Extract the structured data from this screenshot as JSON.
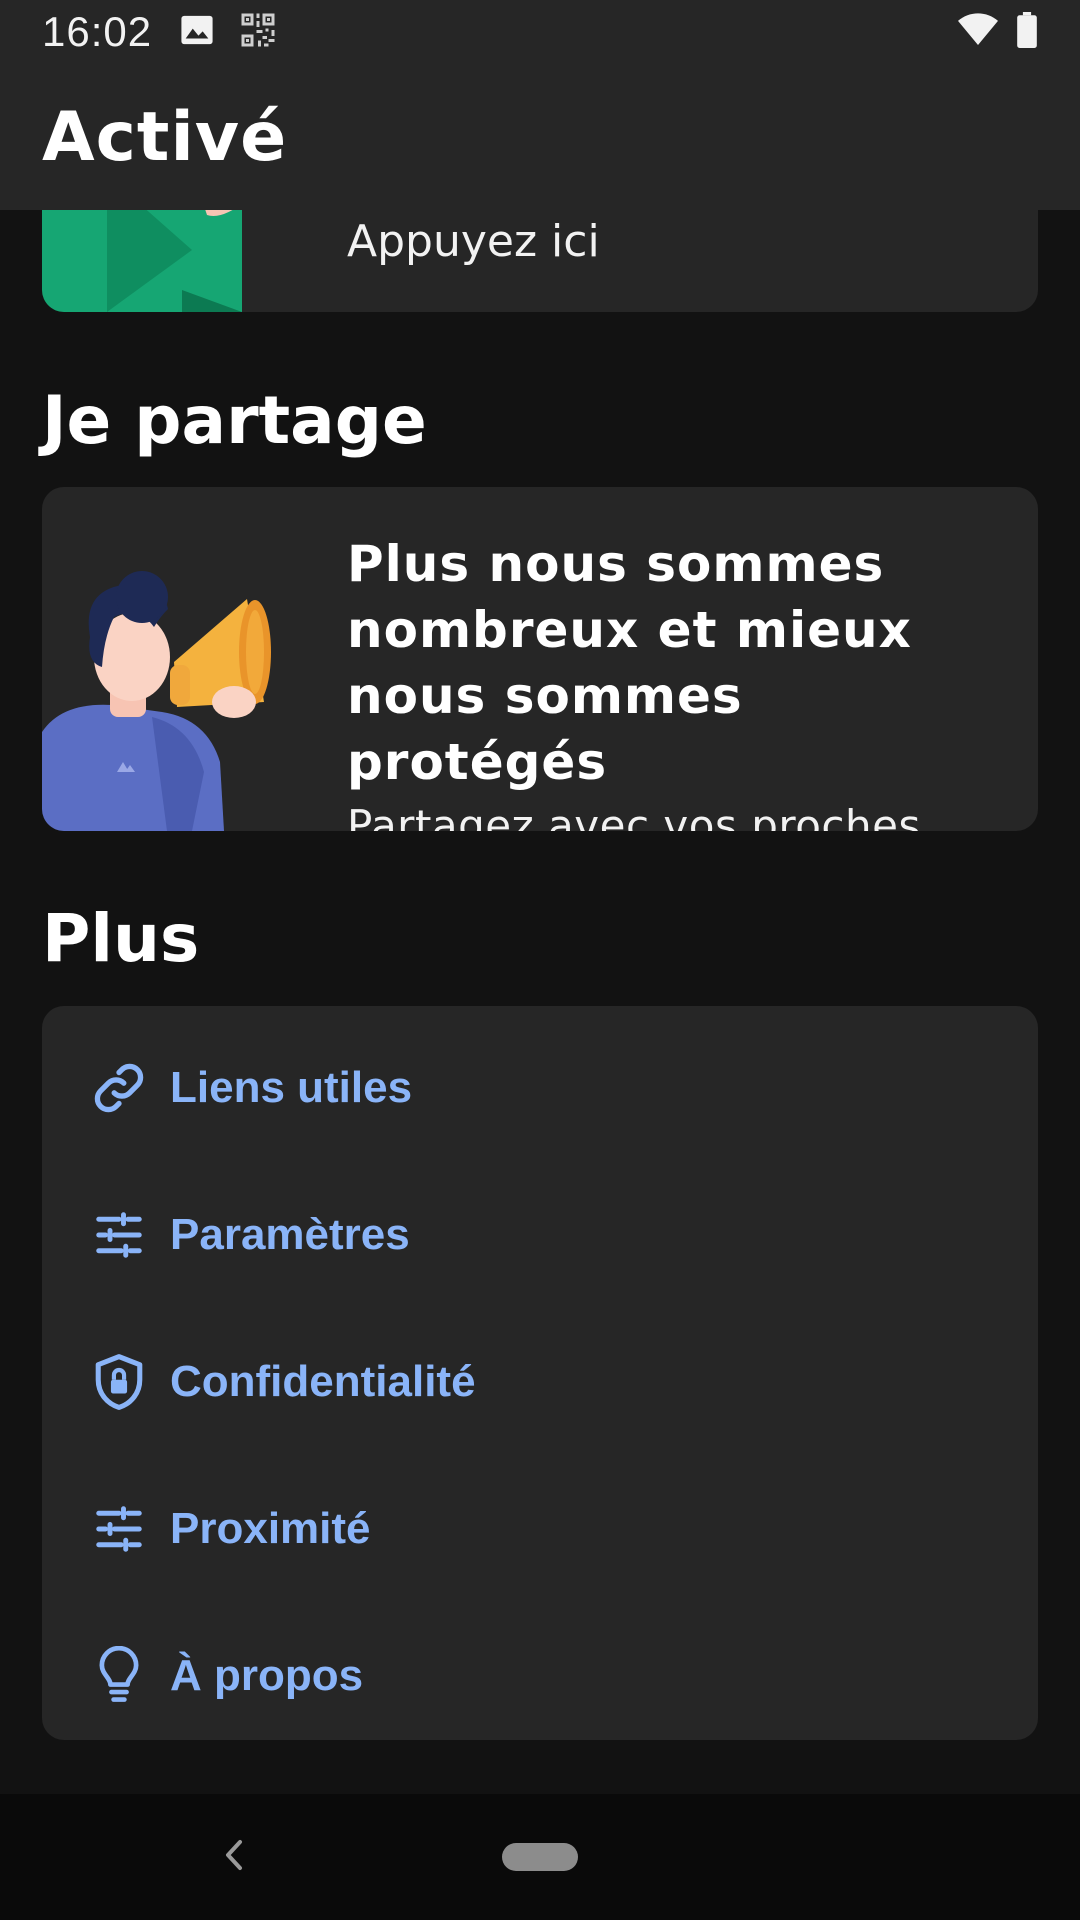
{
  "status_bar": {
    "time": "16:02",
    "icons_left": [
      "image-icon",
      "qr-code-icon"
    ],
    "icons_right": [
      "wifi-icon",
      "battery-icon"
    ]
  },
  "app_bar": {
    "title": "Activé"
  },
  "top_card": {
    "text": "Appuyez ici"
  },
  "share_section": {
    "title": "Je partage",
    "card": {
      "headline": "Plus nous sommes nombreux et mieux nous sommes protégés",
      "subtitle": "Partagez avec vos proches"
    }
  },
  "more_section": {
    "title": "Plus",
    "items": [
      {
        "label": "Liens utiles",
        "icon": "link-icon"
      },
      {
        "label": "Paramètres",
        "icon": "sliders-icon"
      },
      {
        "label": "Confidentialité",
        "icon": "shield-lock-icon"
      },
      {
        "label": "Proximité",
        "icon": "sliders-icon"
      },
      {
        "label": "À propos",
        "icon": "lightbulb-icon"
      }
    ]
  },
  "colors": {
    "background": "#121212",
    "surface": "#262626",
    "accent": "#8ab4f8"
  }
}
